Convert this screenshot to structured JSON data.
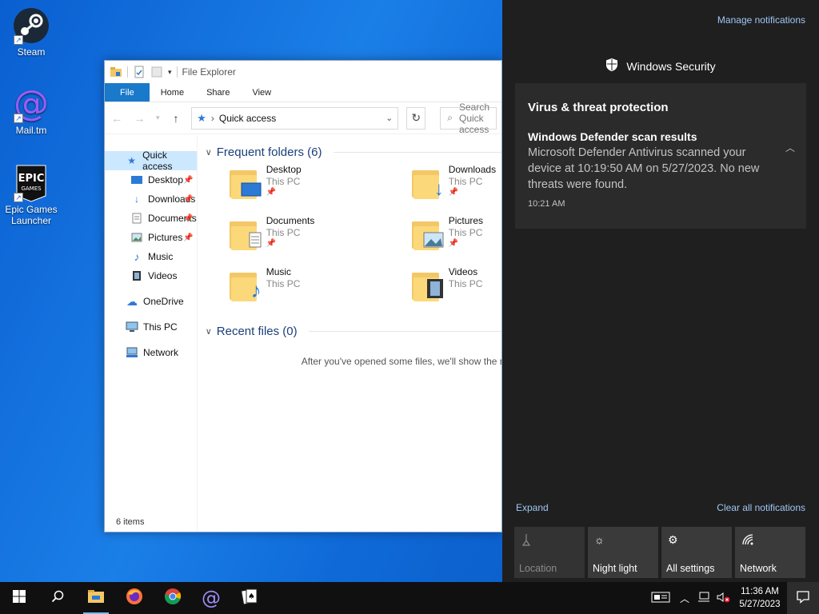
{
  "desktop": {
    "icons": [
      {
        "label": "Steam"
      },
      {
        "label": "Mail.tm"
      },
      {
        "label": "Epic Games Launcher"
      }
    ]
  },
  "explorer": {
    "title": "File Explorer",
    "ribbon_tabs": [
      "File",
      "Home",
      "Share",
      "View"
    ],
    "address": "Quick access",
    "search_placeholder": "Search Quick access",
    "nav": [
      {
        "label": "Quick access"
      },
      {
        "label": "Desktop"
      },
      {
        "label": "Downloads"
      },
      {
        "label": "Documents"
      },
      {
        "label": "Pictures"
      },
      {
        "label": "Music"
      },
      {
        "label": "Videos"
      },
      {
        "label": "OneDrive"
      },
      {
        "label": "This PC"
      },
      {
        "label": "Network"
      }
    ],
    "frequent_header": "Frequent folders (6)",
    "folders": [
      {
        "name": "Desktop",
        "location": "This PC"
      },
      {
        "name": "Downloads",
        "location": "This PC"
      },
      {
        "name": "Documents",
        "location": "This PC"
      },
      {
        "name": "Pictures",
        "location": "This PC"
      },
      {
        "name": "Music",
        "location": "This PC"
      },
      {
        "name": "Videos",
        "location": "This PC"
      }
    ],
    "recent_header": "Recent files (0)",
    "recent_message": "After you've opened some files, we'll show the most recent ones here.",
    "status": "6 items"
  },
  "action_center": {
    "manage": "Manage notifications",
    "app_name": "Windows Security",
    "card_title": "Virus & threat protection",
    "notif_title": "Windows Defender scan results",
    "notif_body": "Microsoft Defender Antivirus scanned your device at 10:19:50 AM on 5/27/2023. No new threats were found.",
    "notif_time": "10:21 AM",
    "expand": "Expand",
    "clear_all": "Clear all notifications",
    "tiles": [
      {
        "label": "Location",
        "icon": "location-icon",
        "enabled": false
      },
      {
        "label": "Night light",
        "icon": "night-light-icon",
        "enabled": true
      },
      {
        "label": "All settings",
        "icon": "gear-icon",
        "enabled": true
      },
      {
        "label": "Network",
        "icon": "network-icon",
        "enabled": true
      }
    ]
  },
  "taskbar": {
    "time": "11:36 AM",
    "date": "5/27/2023",
    "accent": "#76b9ed"
  }
}
